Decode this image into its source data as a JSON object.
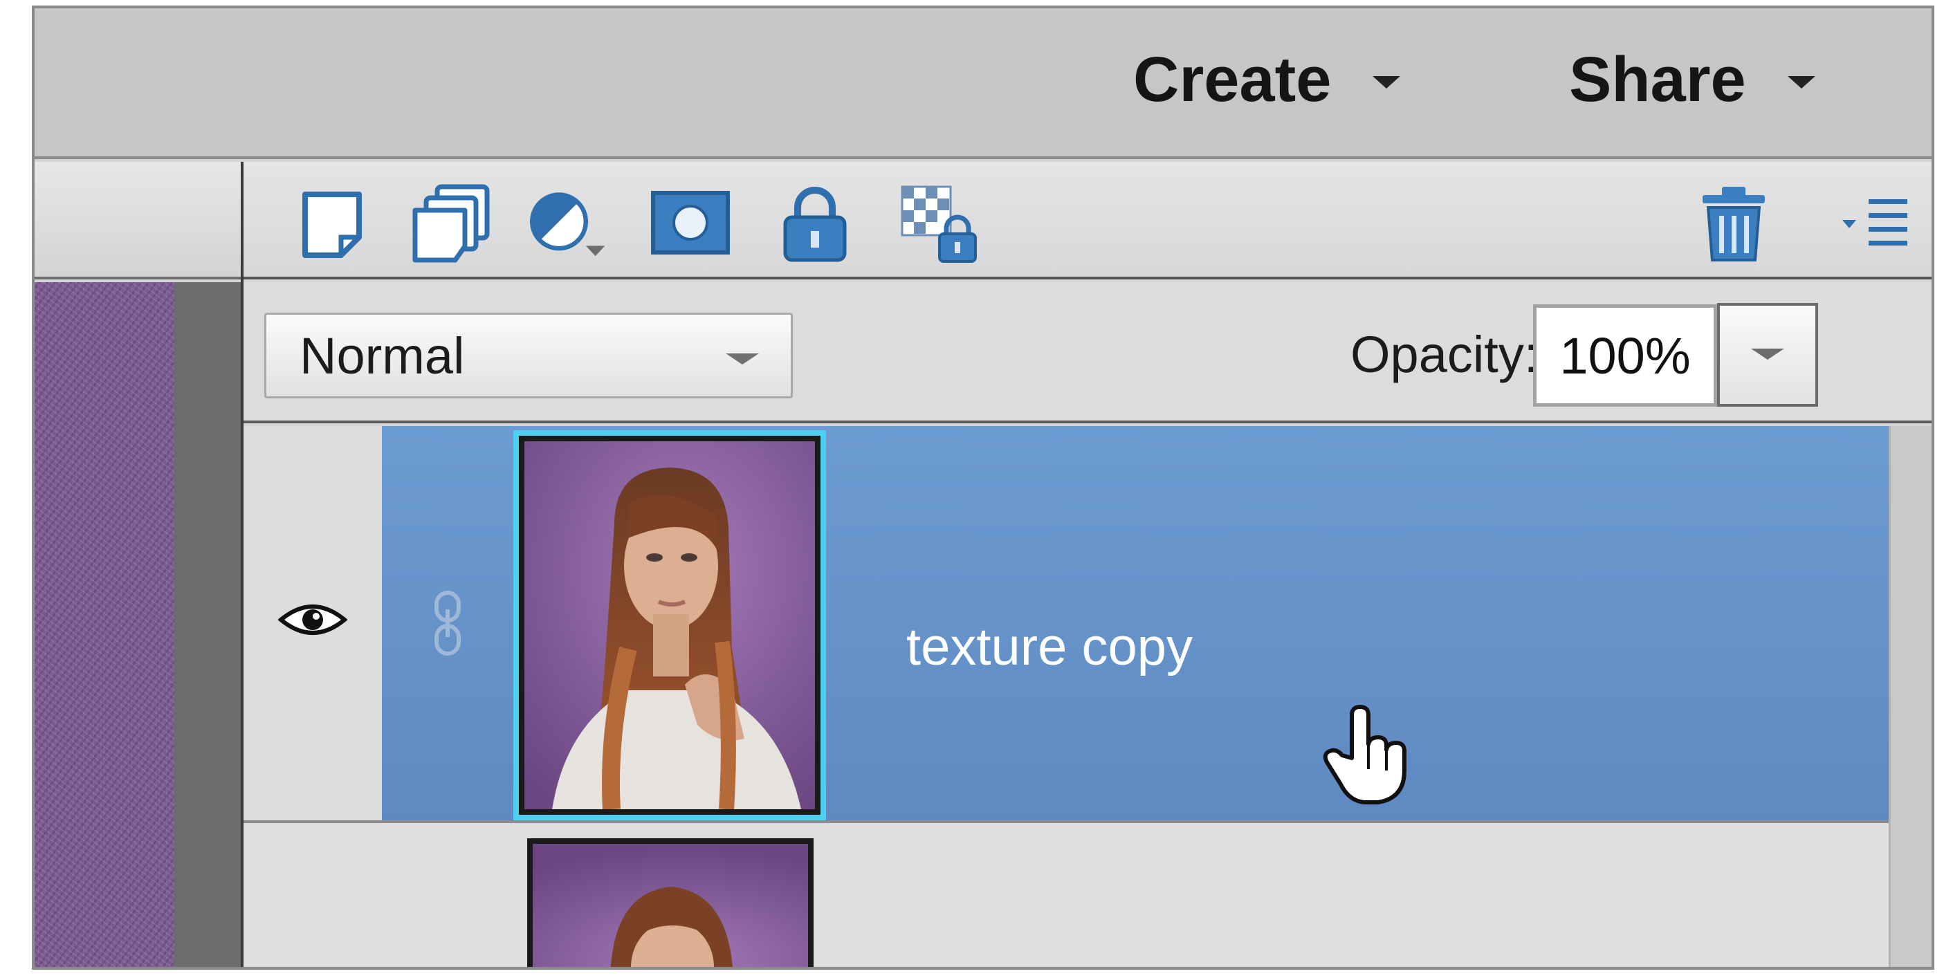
{
  "topbar": {
    "create_label": "Create",
    "share_label": "Share"
  },
  "toolbar": {
    "icons": [
      "new-layer-icon",
      "new-group-icon",
      "adjustment-layer-icon",
      "layer-mask-icon",
      "lock-all-icon",
      "lock-transparency-icon",
      "trash-icon",
      "panel-menu-icon"
    ]
  },
  "blend": {
    "mode_value": "Normal",
    "opacity_label": "Opacity:",
    "opacity_value": "100%"
  },
  "layers": {
    "items": [
      {
        "name": "texture copy",
        "selected": true,
        "visible": true
      },
      {
        "name": "",
        "selected": false
      }
    ]
  },
  "colors": {
    "selection": "#6a98d0",
    "thumbnail_highlight": "#4fd0f0",
    "texture_purple": "#7b5a91"
  }
}
